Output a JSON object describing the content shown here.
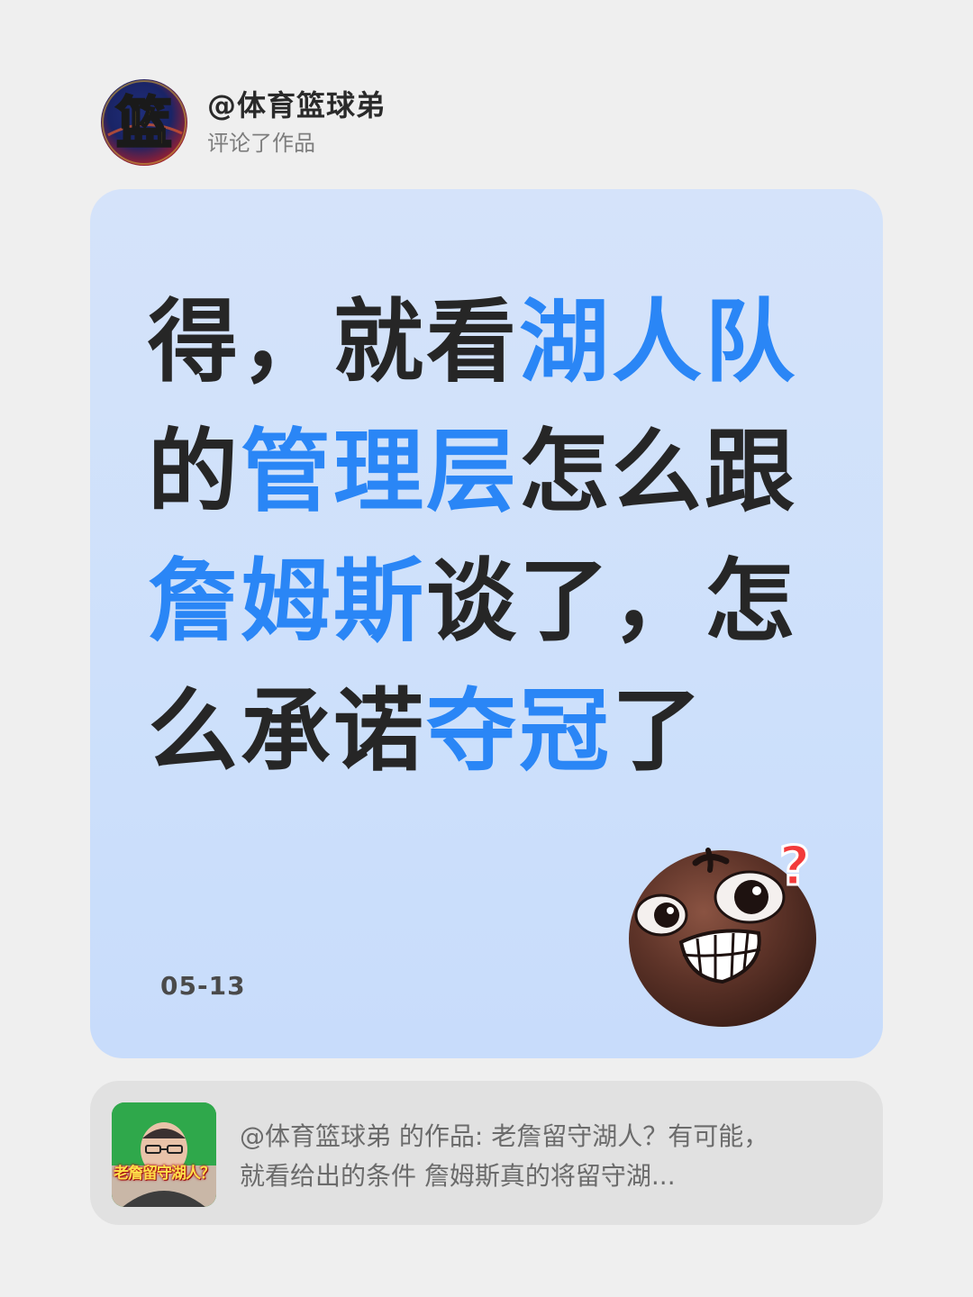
{
  "header": {
    "avatar_logo_char": "篮",
    "username": "@体育篮球弟",
    "action": "评论了作品"
  },
  "comment": {
    "segments": [
      {
        "text": "得，就看",
        "highlight": false
      },
      {
        "text": "湖人队",
        "highlight": true
      },
      {
        "text": "的",
        "highlight": false
      },
      {
        "text": "管理层",
        "highlight": true
      },
      {
        "text": "怎么跟",
        "highlight": false
      },
      {
        "text": "詹姆斯",
        "highlight": true
      },
      {
        "text": "谈了，怎么承诺",
        "highlight": false
      },
      {
        "text": "夺冠",
        "highlight": true
      },
      {
        "text": "了",
        "highlight": false
      }
    ],
    "date": "05-13",
    "emoji_icon": "smirk-question-emoji-icon",
    "highlight_color": "#2a86f6",
    "text_color": "#262626"
  },
  "reference": {
    "thumbnail_caption": "老詹留守湖人？",
    "line1": "@体育篮球弟 的作品: 老詹留守湖人？有可能，",
    "line2": "就看给出的条件 詹姆斯真的将留守湖..."
  },
  "colors": {
    "background": "#efefef",
    "card": "#cde0fb",
    "reference_card": "#e1e1e1"
  }
}
